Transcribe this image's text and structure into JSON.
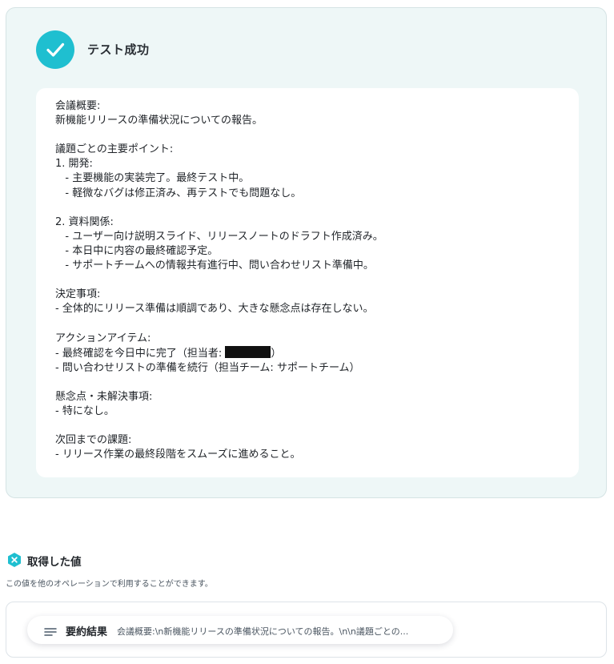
{
  "test_result": {
    "status_title": "テスト成功",
    "summary_lines": [
      "会議概要:",
      "新機能リリースの準備状況についての報告。",
      "",
      "議題ごとの主要ポイント:",
      "1. 開発:",
      "   - 主要機能の実装完了。最終テスト中。",
      "   - 軽微なバグは修正済み、再テストでも問題なし。",
      "",
      "2. 資料関係:",
      "   - ユーザー向け説明スライド、リリースノートのドラフト作成済み。",
      "   - 本日中に内容の最終確認予定。",
      "   - サポートチームへの情報共有進行中、問い合わせリスト準備中。",
      "",
      "決定事項:",
      "- 全体的にリリース準備は順調であり、大きな懸念点は存在しない。",
      "",
      "アクションアイテム:",
      "- 最終確認を今日中に完了（担当者: ",
      "- 問い合わせリストの準備を続行（担当チーム: サポートチーム）",
      "",
      "懸念点・未解決事項:",
      "- 特になし。",
      "",
      "次回までの課題:",
      "- リリース作業の最終段階をスムーズに進めること。"
    ],
    "redacted_suffix": "）"
  },
  "acquired": {
    "title": "取得した値",
    "description": "この値を他のオペレーションで利用することができます。",
    "items": [
      {
        "label": "要約結果",
        "value": "会議概要:\\n新機能リリースの準備状況についての報告。\\n\\n議題ごとの..."
      }
    ]
  },
  "icons": {
    "success": "checkmark-icon",
    "acquired": "close-badge-icon",
    "value": "text-lines-icon"
  },
  "colors": {
    "accent": "#1fbfd0",
    "panel_background": "#eef7f7"
  }
}
